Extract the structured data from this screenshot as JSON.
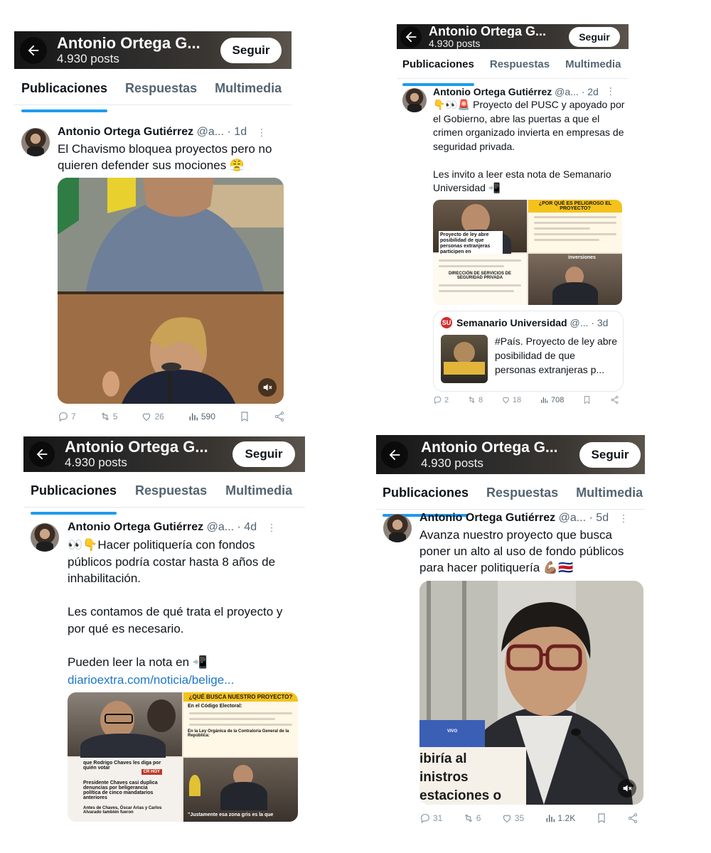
{
  "profile": {
    "name_truncated": "Antonio Ortega G...",
    "posts": "4.930 posts",
    "follow_label": "Seguir",
    "tabs": [
      "Publicaciones",
      "Respuestas",
      "Multimedia"
    ]
  },
  "tweets": [
    {
      "author": "Antonio Ortega Gutiérrez",
      "handle": "@a...",
      "time": "· 1d",
      "text": "El Chavismo bloquea proyectos pero no quieren defender sus mociones 😤",
      "replies": "7",
      "retweets": "5",
      "likes": "26",
      "views": "590"
    },
    {
      "author": "Antonio Ortega Gutiérrez",
      "handle": "@a...",
      "time": "· 2d",
      "text": "👇👀🚨 Proyecto del PUSC y apoyado por el Gobierno, abre las puertas a que el crimen organizado invierta en empresas de seguridad privada.\n\nLes invito a leer esta nota de Semanario Universidad 📲",
      "infographic": {
        "title": "¿POR QUÉ ES PELIGROSO EL PROYECTO?",
        "caption": "Proyecto de ley abre posibilidad de que personas extranjeras participen en",
        "section": "DIRECCIÓN DE SERVICIOS DE SEGURIDAD PRIVADA",
        "tag": "inversiones"
      },
      "quote": {
        "source": "Semanario Universidad",
        "handle": "@...",
        "time": "· 3d",
        "text": "#País. Proyecto de ley abre posibilidad de que personas extranjeras p..."
      },
      "replies": "2",
      "retweets": "8",
      "likes": "18",
      "views": "708"
    },
    {
      "author": "Antonio Ortega Gutiérrez",
      "handle": "@a...",
      "time": "· 4d",
      "text": "👀👇Hacer politiquería con fondos públicos podría costar hasta 8 años de inhabilitación.\n\nLes contamos de qué trata el proyecto y por qué es necesario.\n\nPueden leer la nota en 📲",
      "link": "diarioextra.com/noticia/belige...",
      "infographic": {
        "title": "¿QUÉ BUSCA NUESTRO PROYECTO?",
        "sub1": "En el Código Electoral:",
        "sub2": "En la Ley Orgánica de la Contraloría General de la República:",
        "news1": "que Rodrigo Chaves les diga por quién votar",
        "news1_tag": "CR HOY",
        "news2": "Presidente Chaves casi duplica denuncias por beligerancia política de cinco mandatarios anteriores",
        "news3": "Antes de Chaves, Óscar Arias y Carlos Alvarado también fueron",
        "quote": "\"Justamente esa zona gris es la que"
      }
    },
    {
      "author": "Antonio Ortega Gutiérrez",
      "handle": "@a...",
      "time": "· 5d",
      "text": "Avanza nuestro proyecto que busca poner un alto al uso de fondo públicos para hacer politiquería 💪🏽🇨🇷",
      "video_caption": "ibiría al\ninistros\nestaciones o",
      "video_tag": "VIVO",
      "replies": "31",
      "retweets": "6",
      "likes": "35",
      "views": "1.2K"
    }
  ],
  "colors": {
    "accent": "#1d9bf0",
    "link": "#1d77c9",
    "muted": "#536471"
  }
}
